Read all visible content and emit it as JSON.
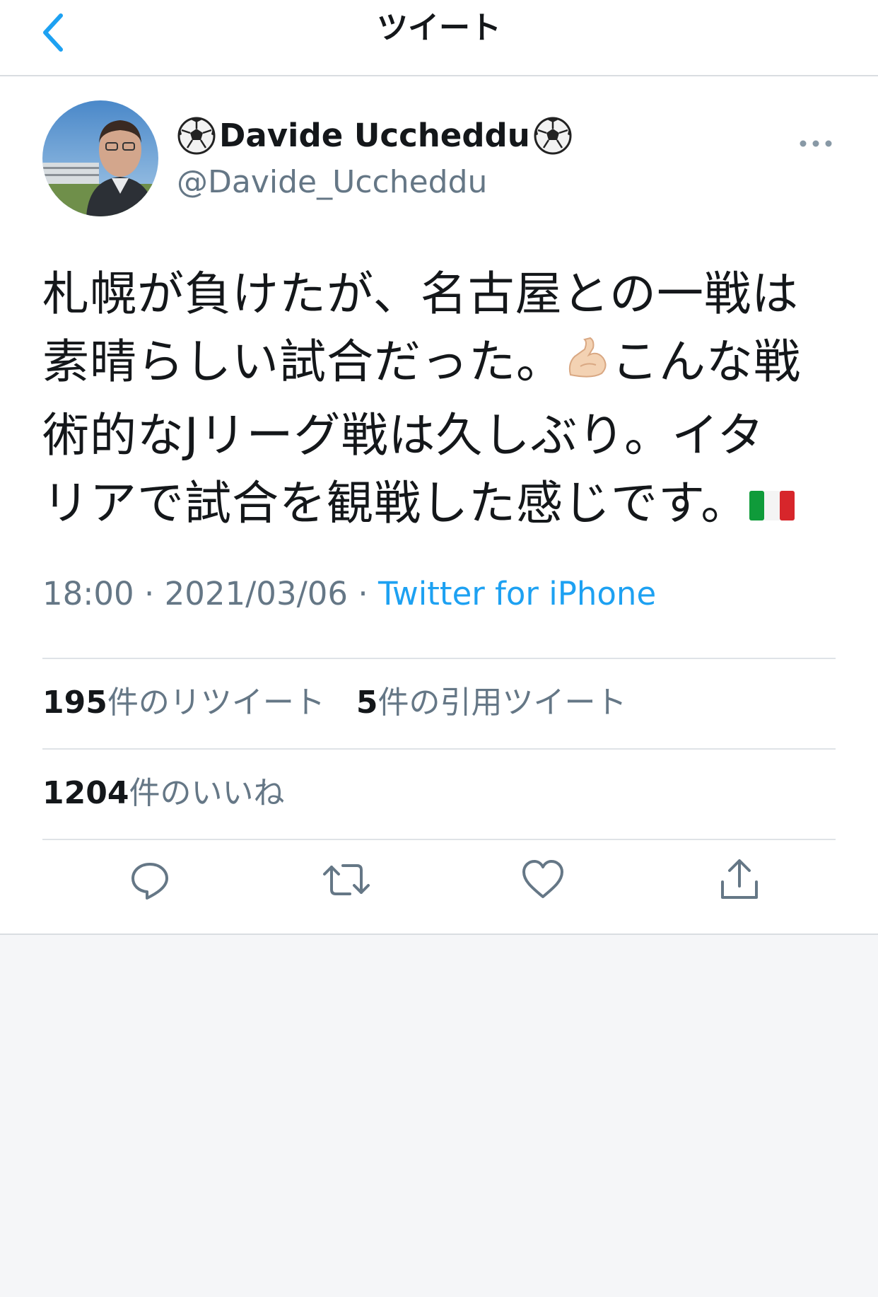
{
  "header": {
    "title": "ツイート",
    "back_icon": "chevron-left-icon"
  },
  "tweet": {
    "author": {
      "display_name": "Davide Uccheddu",
      "name_emoji_left": "⚽",
      "name_emoji_right": "⚽",
      "handle": "@Davide_Uccheddu"
    },
    "text_lines": [
      "札幌が負けたが、名古屋との一戦は",
      "素晴らしい試合だった。",
      "こんな戦",
      "術的なJリーグ戦は久しぶり。イタ",
      "リアで試合を観戦した感じです。"
    ],
    "emojis": {
      "muscle": "💪🏻",
      "flag": "🇮🇹"
    },
    "time": "18:00",
    "date": "2021/03/06",
    "separator": "·",
    "source": "Twitter for iPhone",
    "retweets_count": "195",
    "retweets_label": "件のリツイート",
    "quotes_count": "5",
    "quotes_label": "件の引用ツイート",
    "likes_count": "1204",
    "likes_label": "件のいいね"
  },
  "actions": [
    "reply-icon",
    "retweet-icon",
    "like-icon",
    "share-icon"
  ],
  "colors": {
    "accent": "#1da1f2",
    "secondary_text": "#657786",
    "divider": "#dfe3e7",
    "page_background": "#f5f6f8"
  }
}
